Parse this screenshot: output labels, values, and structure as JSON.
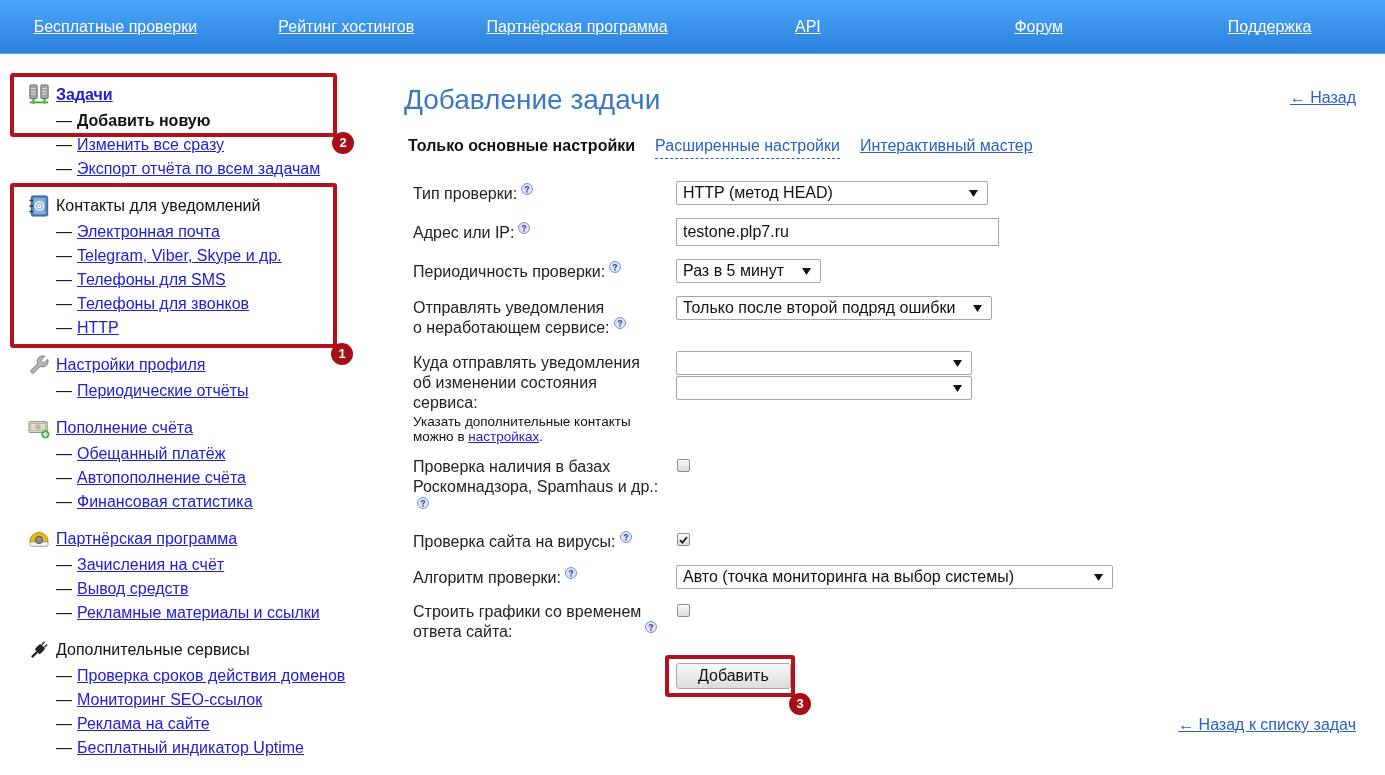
{
  "nav": {
    "links": [
      "Бесплатные проверки",
      "Рейтинг хостингов",
      "Партнёрская программа",
      "API",
      "Форум",
      "Поддержка"
    ]
  },
  "sidebar": {
    "groups": [
      {
        "title": "Задачи",
        "kind": "link",
        "selected": true,
        "items": [
          {
            "dash": "—",
            "label": "Добавить новую",
            "selected": true
          },
          {
            "dash": "—",
            "label": "Изменить все сразу",
            "selected": false
          },
          {
            "dash": "—",
            "label": "Экспорт отчёта по всем задачам",
            "selected": false
          }
        ]
      },
      {
        "title": "Контакты для уведомлений",
        "kind": "heading",
        "selected": false,
        "items": [
          {
            "dash": "—",
            "label": "Электронная почта",
            "selected": false
          },
          {
            "dash": "—",
            "label": "Telegram, Viber, Skype и др.",
            "selected": false
          },
          {
            "dash": "—",
            "label": "Телефоны для SMS",
            "selected": false
          },
          {
            "dash": "—",
            "label": "Телефоны для звонков",
            "selected": false
          },
          {
            "dash": "—",
            "label": "HTTP",
            "selected": false
          }
        ]
      },
      {
        "title": "Настройки профиля",
        "kind": "link",
        "selected": false,
        "items": [
          {
            "dash": "—",
            "label": "Периодические отчёты",
            "selected": false
          }
        ]
      },
      {
        "title": "Пополнение счёта",
        "kind": "link",
        "selected": false,
        "items": [
          {
            "dash": "—",
            "label": "Обещанный платёж",
            "selected": false
          },
          {
            "dash": "—",
            "label": "Автопополнение счёта",
            "selected": false
          },
          {
            "dash": "—",
            "label": "Финансовая статистика",
            "selected": false
          }
        ]
      },
      {
        "title": "Партнёрская программа",
        "kind": "link",
        "selected": false,
        "items": [
          {
            "dash": "—",
            "label": "Зачисления на счёт",
            "selected": false
          },
          {
            "dash": "—",
            "label": "Вывод средств",
            "selected": false
          },
          {
            "dash": "—",
            "label": "Рекламные материалы и ссылки",
            "selected": false
          }
        ]
      },
      {
        "title": "Дополнительные сервисы",
        "kind": "heading",
        "selected": false,
        "items": [
          {
            "dash": "—",
            "label": "Проверка сроков действия доменов",
            "selected": false
          },
          {
            "dash": "—",
            "label": "Мониторинг SEO-ссылок",
            "selected": false
          },
          {
            "dash": "—",
            "label": "Реклама на сайте",
            "selected": false
          },
          {
            "dash": "—",
            "label": "Бесплатный индикатор Uptime",
            "selected": false
          }
        ]
      }
    ]
  },
  "main": {
    "title": "Добавление задачи",
    "back_link": "← Назад",
    "tabs": [
      {
        "label": "Только основные настройки",
        "selected": true
      },
      {
        "label": "Расширенные настройки",
        "kind": "toggle",
        "selected": false
      },
      {
        "label": "Интерактивный мастер",
        "kind": "link",
        "selected": false
      }
    ],
    "form": {
      "rows": [
        {
          "label": "Тип проверки:",
          "help": true,
          "controls": [
            {
              "kind": "select",
              "value": "HTTP (метод HEAD)"
            }
          ]
        },
        {
          "label": "Адрес или IP:",
          "help": true,
          "controls": [
            {
              "kind": "input",
              "value": "testone.plp7.ru"
            }
          ]
        },
        {
          "label": "Периодичность проверки:",
          "help": true,
          "controls": [
            {
              "kind": "select",
              "value": "Раз в 5 минут"
            }
          ]
        },
        {
          "label": "Отправлять уведомления\nо неработающем сервисе:",
          "help": true,
          "controls": [
            {
              "kind": "select",
              "value": "Только после второй подряд ошибки"
            }
          ]
        },
        {
          "label": "Куда отправлять уведомления\nоб изменении состояния\nсервиса:",
          "help": false,
          "note": {
            "text": "Указать дополнительные контакты\nможно в ",
            "link": "настройках",
            "end": "."
          },
          "controls": [
            {
              "kind": "select"
            },
            {
              "kind": "select"
            }
          ]
        },
        {
          "label": "Проверка наличия в базах\nРоскомнадзора, Spamhaus и др.:",
          "help": true,
          "controls": [
            {
              "kind": "checkbox",
              "checked": false
            }
          ]
        },
        {
          "label": "Проверка сайта на вирусы:",
          "help": true,
          "controls": [
            {
              "kind": "checkbox",
              "checked": true
            }
          ]
        },
        {
          "label": "Алгоритм проверки:",
          "help": true,
          "controls": [
            {
              "kind": "select",
              "value": "Авто (точка мониторинга на выбор системы)"
            }
          ]
        },
        {
          "label": "Строить графики со временем\nответа сайта:",
          "help": true,
          "controls": [
            {
              "kind": "checkbox",
              "checked": false
            }
          ]
        }
      ]
    },
    "submit": "Добавить",
    "back_to_list": "← Назад к списку задач"
  },
  "callouts": [
    {
      "number": "2"
    },
    {
      "number": "1"
    },
    {
      "number": "3"
    }
  ]
}
